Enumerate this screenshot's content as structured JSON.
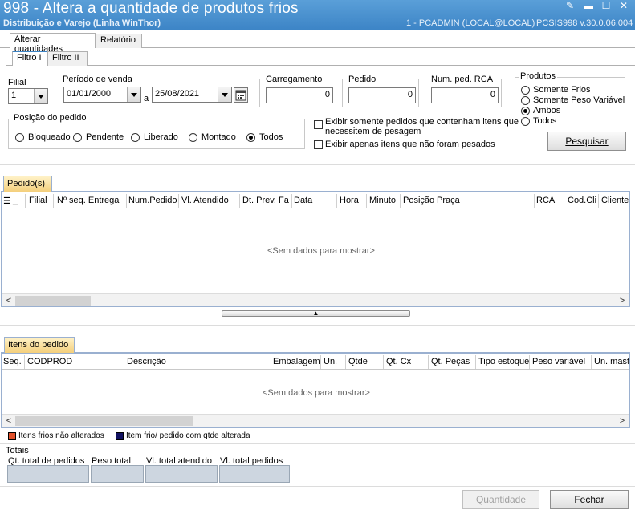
{
  "window": {
    "title": "998 - Altera a quantidade de produtos frios",
    "subtitle": "Distribuição e Varejo (Linha WinThor)",
    "status": "1 - PCADMIN (LOCAL@LOCAL)",
    "program": "PCSIS998  v.30.0.06.004"
  },
  "tabs": {
    "main": [
      "Alterar quantidades",
      "Relatório"
    ],
    "filter": [
      "Filtro I",
      "Filtro II"
    ]
  },
  "filters": {
    "filial_label": "Filial",
    "filial_value": "1",
    "periodo_label": "Período de venda",
    "date_from": "01/01/2000",
    "date_sep": "a",
    "date_to": "25/08/2021",
    "carregamento_label": "Carregamento",
    "carregamento_value": "0",
    "pedido_label": "Pedido",
    "pedido_value": "0",
    "num_ped_rca_label": "Num. ped. RCA",
    "num_ped_rca_value": "0",
    "posicao_label": "Posição do pedido",
    "posicao_options": [
      "Bloqueado",
      "Pendente",
      "Liberado",
      "Montado",
      "Todos"
    ],
    "posicao_selected": "Todos",
    "check_pesagem_line1": "Exibir somente pedidos que contenham itens que",
    "check_pesagem_line2": "necessitem  de pesagem",
    "check_nao_pesados": "Exibir apenas itens que não foram pesados",
    "produtos_label": "Produtos",
    "produtos_options": [
      "Somente Frios",
      "Somente Peso Variável",
      "Ambos",
      "Todos"
    ],
    "produtos_selected": "Ambos",
    "pesquisar": "Pesquisar"
  },
  "pedidos_grid": {
    "tab": "Pedido(s)",
    "columns": [
      "_",
      "Filial",
      "Nº seq. Entrega",
      "Num.Pedido",
      "Vl. Atendido",
      "Dt. Prev. Fa",
      "Data",
      "Hora",
      "Minuto",
      "Posição",
      "Praça",
      "RCA",
      "Cod.Cli",
      "Cliente"
    ],
    "empty": "<Sem dados para mostrar>"
  },
  "itens_grid": {
    "tab": "Itens do pedido",
    "columns": [
      "Seq.",
      "CODPROD",
      "Descrição",
      "Embalagem",
      "Un.",
      "Qtde",
      "Qt. Cx",
      "Qt. Peças",
      "Tipo estoque",
      "Peso variável",
      "Un. mast"
    ],
    "empty": "<Sem dados para mostrar>"
  },
  "legend": {
    "not_changed": "Itens frios não alterados",
    "changed": "Item frio/ pedido com qtde alterada",
    "not_changed_color": "#e0502a",
    "changed_color": "#101060"
  },
  "totals": {
    "title": "Totais",
    "labels": [
      "Qt. total de pedidos",
      "Peso total",
      "Vl. total atendido",
      "Vl. total pedidos"
    ]
  },
  "footer": {
    "quantidade": "Quantidade",
    "fechar": "Fechar"
  }
}
